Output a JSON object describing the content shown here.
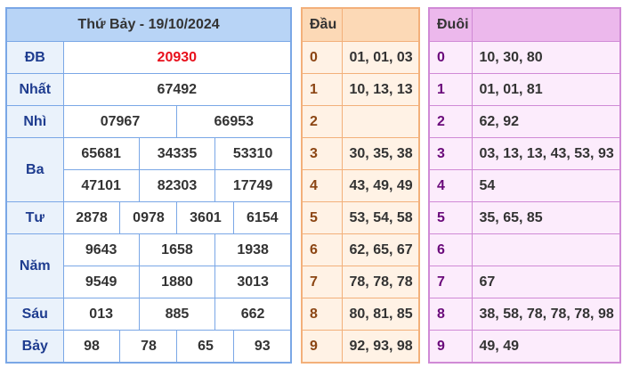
{
  "results": {
    "title": "Thứ Bảy - 19/10/2024",
    "rows": [
      {
        "label": "ĐB",
        "values": [
          "20930"
        ]
      },
      {
        "label": "Nhất",
        "values": [
          "67492"
        ]
      },
      {
        "label": "Nhì",
        "values": [
          "07967",
          "66953"
        ]
      },
      {
        "label": "Ba",
        "values": [
          "65681",
          "34335",
          "53310",
          "47101",
          "82303",
          "17749"
        ]
      },
      {
        "label": "Tư",
        "values": [
          "2878",
          "0978",
          "3601",
          "6154"
        ]
      },
      {
        "label": "Năm",
        "values": [
          "9643",
          "1658",
          "1938",
          "9549",
          "1880",
          "3013"
        ]
      },
      {
        "label": "Sáu",
        "values": [
          "013",
          "885",
          "662"
        ]
      },
      {
        "label": "Bảy",
        "values": [
          "98",
          "78",
          "65",
          "93"
        ]
      }
    ]
  },
  "heads": {
    "header": "Đầu",
    "rows": [
      {
        "digit": "0",
        "values": "01, 01, 03"
      },
      {
        "digit": "1",
        "values": "10, 13, 13"
      },
      {
        "digit": "2",
        "values": ""
      },
      {
        "digit": "3",
        "values": "30, 35, 38"
      },
      {
        "digit": "4",
        "values": "43, 49, 49"
      },
      {
        "digit": "5",
        "values": "53, 54, 58"
      },
      {
        "digit": "6",
        "values": "62, 65, 67"
      },
      {
        "digit": "7",
        "values": "78, 78, 78"
      },
      {
        "digit": "8",
        "values": "80, 81, 85"
      },
      {
        "digit": "9",
        "values": "92, 93, 98"
      }
    ]
  },
  "tails": {
    "header": "Đuôi",
    "rows": [
      {
        "digit": "0",
        "values": "10, 30, 80"
      },
      {
        "digit": "1",
        "values": "01, 01, 81"
      },
      {
        "digit": "2",
        "values": "62, 92"
      },
      {
        "digit": "3",
        "values": "03, 13, 13, 43, 53, 93"
      },
      {
        "digit": "4",
        "values": "54"
      },
      {
        "digit": "5",
        "values": "35, 65, 85"
      },
      {
        "digit": "6",
        "values": ""
      },
      {
        "digit": "7",
        "values": "67"
      },
      {
        "digit": "8",
        "values": "38, 58, 78, 78, 78, 98"
      },
      {
        "digit": "9",
        "values": "49, 49"
      }
    ]
  },
  "colors": {
    "special_prize": "#e8101c",
    "results_border": "#7aa7e6",
    "heads_border": "#f3b07a",
    "tails_border": "#d08ad6"
  }
}
